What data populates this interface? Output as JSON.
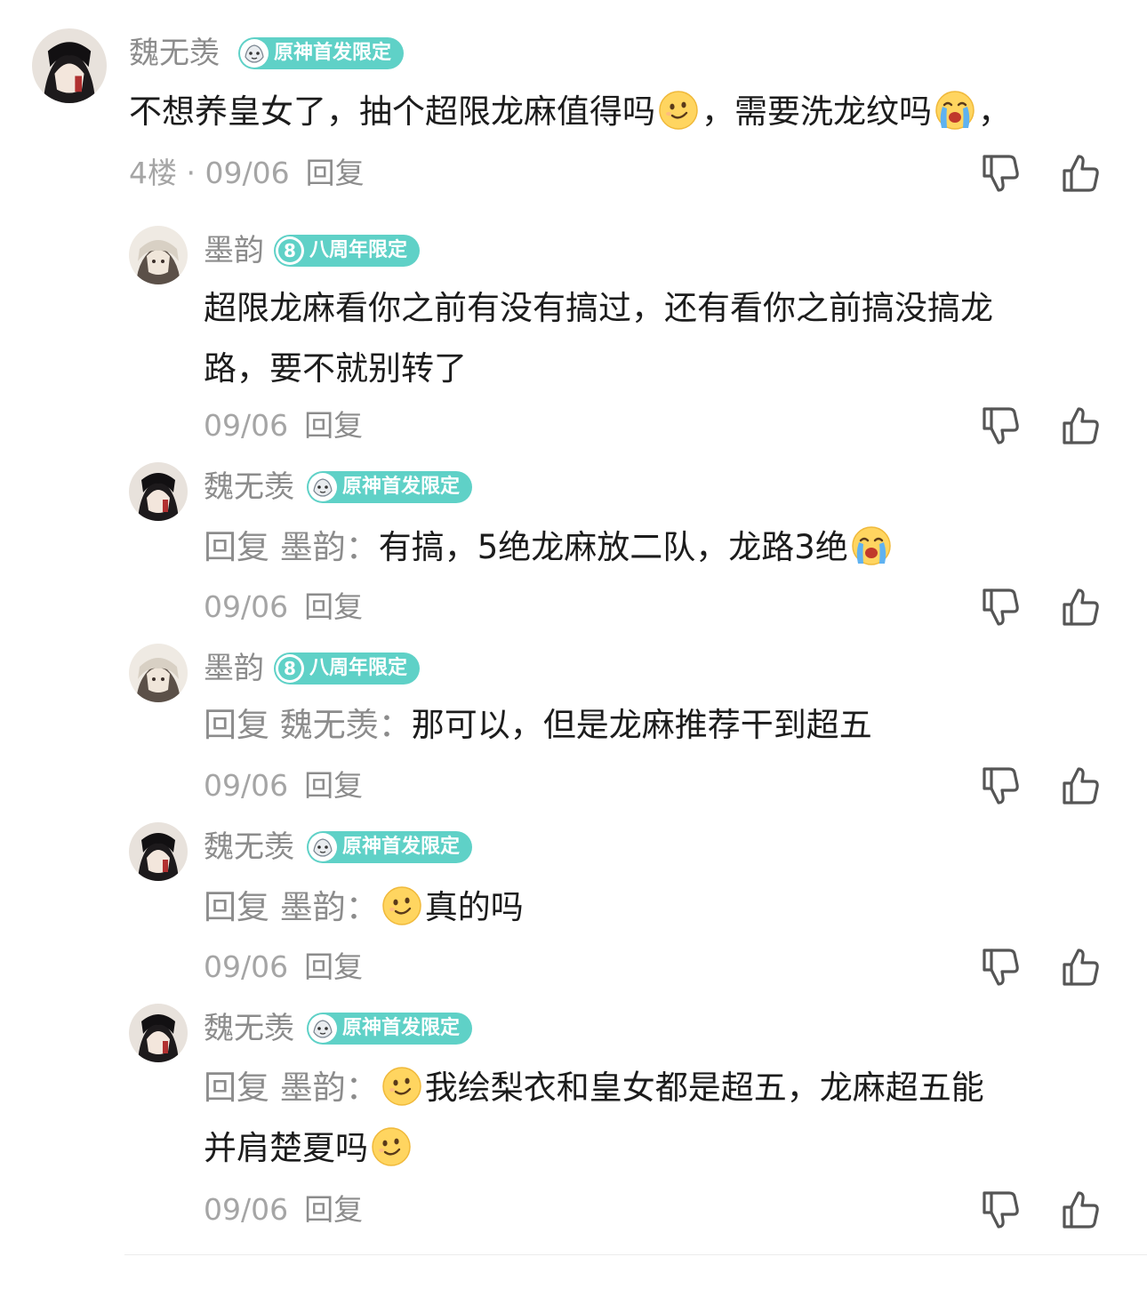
{
  "comments": [
    {
      "user": "魏无羡",
      "badge": "原神首发限定",
      "line1": "不想养皇女了，抽个超限龙麻值得吗",
      "line1b": "，需要洗龙纹吗",
      "line1c": "，",
      "floor": "4楼 · 09/06",
      "reply_label": "回复"
    },
    {
      "user": "墨韵",
      "badge": "八周年限定",
      "line1": "超限龙麻看你之前有没有搞过，还有看你之前搞没搞龙",
      "line2": "路，要不就别转了",
      "date": "09/06",
      "reply_label": "回复"
    },
    {
      "user": "魏无羡",
      "badge": "原神首发限定",
      "prefix": "回复 墨韵：",
      "line1": "有搞，5绝龙麻放二队，龙路3绝",
      "date": "09/06",
      "reply_label": "回复"
    },
    {
      "user": "墨韵",
      "badge": "八周年限定",
      "prefix": "回复 魏无羡：",
      "line1": "那可以，但是龙麻推荐干到超五",
      "date": "09/06",
      "reply_label": "回复"
    },
    {
      "user": "魏无羡",
      "badge": "原神首发限定",
      "prefix": "回复 墨韵：",
      "line1": "真的吗",
      "date": "09/06",
      "reply_label": "回复"
    },
    {
      "user": "魏无羡",
      "badge": "原神首发限定",
      "prefix": "回复 墨韵：",
      "line1": "我绘梨衣和皇女都是超五，龙麻超五能",
      "line2": "并肩楚夏吗",
      "date": "09/06",
      "reply_label": "回复"
    }
  ],
  "icons": {
    "dislike": "thumbs-down-icon",
    "like": "thumbs-up-icon",
    "smile_emoji": "smile-emoji",
    "cry_emoji": "crying-emoji"
  },
  "colors": {
    "badge": "#5fd1c7",
    "muted": "#8c8c8c",
    "meta": "#a5a5a5"
  }
}
